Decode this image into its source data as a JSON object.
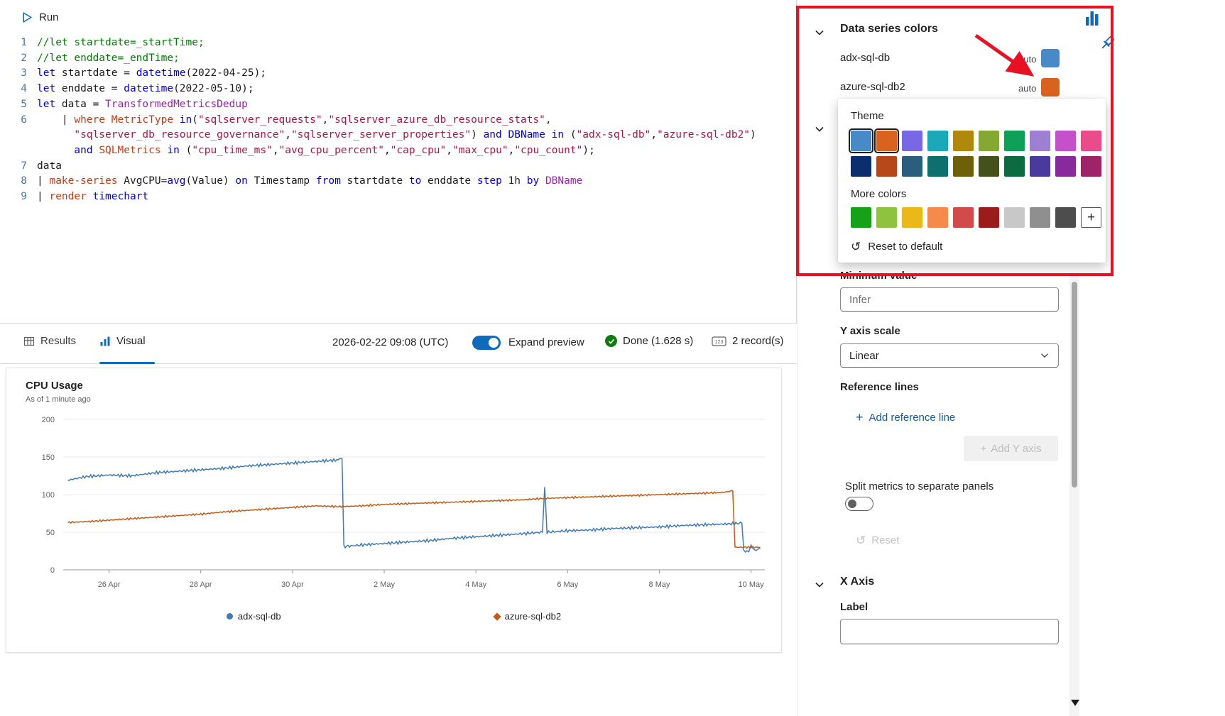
{
  "accent": "#0f6cbd",
  "annotation_color": "#e81123",
  "editor": {
    "run_label": "Run",
    "lines": [
      {
        "num": "1",
        "tokens": [
          [
            "comment",
            "//let startdate=_startTime;"
          ]
        ]
      },
      {
        "num": "2",
        "tokens": [
          [
            "comment",
            "//let enddate=_endTime;"
          ]
        ]
      },
      {
        "num": "3",
        "tokens": [
          [
            "kw",
            "let"
          ],
          [
            "plain",
            " startdate = "
          ],
          [
            "kw",
            "datetime"
          ],
          [
            "plain",
            "(2022-04-25);"
          ]
        ]
      },
      {
        "num": "4",
        "tokens": [
          [
            "kw",
            "let"
          ],
          [
            "plain",
            " enddate = "
          ],
          [
            "kw",
            "datetime"
          ],
          [
            "plain",
            "(2022-05-10);"
          ]
        ]
      },
      {
        "num": "5",
        "tokens": [
          [
            "kw",
            "let"
          ],
          [
            "plain",
            " data = "
          ],
          [
            "table",
            "TransformedMetricsDedup"
          ]
        ]
      },
      {
        "num": "6",
        "tokens": [
          [
            "plain",
            "    | "
          ],
          [
            "op",
            "where"
          ],
          [
            "plain",
            " "
          ],
          [
            "col",
            "MetricType"
          ],
          [
            "plain",
            " "
          ],
          [
            "kw",
            "in"
          ],
          [
            "plain",
            "("
          ],
          [
            "str",
            "\"sqlserver_requests\""
          ],
          [
            "plain",
            ","
          ],
          [
            "str",
            "\"sqlserver_azure_db_resource_stats\""
          ],
          [
            "plain",
            ","
          ]
        ]
      },
      {
        "num": "",
        "tokens": [
          [
            "plain",
            "      "
          ],
          [
            "str",
            "\"sqlserver_db_resource_governance\""
          ],
          [
            "plain",
            ","
          ],
          [
            "str",
            "\"sqlserver_server_properties\""
          ],
          [
            "plain",
            ") "
          ],
          [
            "kw",
            "and"
          ],
          [
            "plain",
            " "
          ],
          [
            "kw",
            "DBName"
          ],
          [
            "plain",
            " "
          ],
          [
            "kw",
            "in"
          ],
          [
            "plain",
            " ("
          ],
          [
            "str",
            "\"adx-sql-db\""
          ],
          [
            "plain",
            ","
          ],
          [
            "str",
            "\"azure-sql-db2\""
          ],
          [
            "plain",
            ")"
          ]
        ]
      },
      {
        "num": "",
        "tokens": [
          [
            "plain",
            "      "
          ],
          [
            "kw",
            "and"
          ],
          [
            "plain",
            " "
          ],
          [
            "col",
            "SQLMetrics"
          ],
          [
            "plain",
            " "
          ],
          [
            "kw",
            "in"
          ],
          [
            "plain",
            " ("
          ],
          [
            "str",
            "\"cpu_time_ms\""
          ],
          [
            "plain",
            ","
          ],
          [
            "str",
            "\"avg_cpu_percent\""
          ],
          [
            "plain",
            ","
          ],
          [
            "str",
            "\"cap_cpu\""
          ],
          [
            "plain",
            ","
          ],
          [
            "str",
            "\"max_cpu\""
          ],
          [
            "plain",
            ","
          ],
          [
            "str",
            "\"cpu_count\""
          ],
          [
            "plain",
            ");"
          ]
        ]
      },
      {
        "num": "7",
        "tokens": [
          [
            "plain",
            "data"
          ]
        ]
      },
      {
        "num": "8",
        "tokens": [
          [
            "plain",
            "| "
          ],
          [
            "op",
            "make-series"
          ],
          [
            "plain",
            " AvgCPU="
          ],
          [
            "fn",
            "avg"
          ],
          [
            "plain",
            "(Value) "
          ],
          [
            "kw",
            "on"
          ],
          [
            "plain",
            " Timestamp "
          ],
          [
            "kw",
            "from"
          ],
          [
            "plain",
            " startdate "
          ],
          [
            "kw",
            "to"
          ],
          [
            "plain",
            " enddate "
          ],
          [
            "kw",
            "step"
          ],
          [
            "plain",
            " 1h "
          ],
          [
            "kw",
            "by"
          ],
          [
            "plain",
            " "
          ],
          [
            "table",
            "DBName"
          ]
        ]
      },
      {
        "num": "9",
        "tokens": [
          [
            "plain",
            "| "
          ],
          [
            "op",
            "render"
          ],
          [
            "plain",
            " "
          ],
          [
            "kw",
            "timechart"
          ]
        ]
      }
    ]
  },
  "results_bar": {
    "results_tab": "Results",
    "visual_tab": "Visual",
    "timestamp": "2026-02-22 09:08 (UTC)",
    "expand_preview_label": "Expand preview",
    "expand_preview_on": true,
    "status_text": "Done (1.628 s)",
    "records_text": "2 record(s)"
  },
  "chart_data": {
    "type": "line",
    "title": "CPU Usage",
    "subtitle": "As of 1 minute ago",
    "ylabel": "",
    "xlabel": "",
    "ylim": [
      0,
      200
    ],
    "yticks": [
      0,
      50,
      100,
      150,
      200
    ],
    "x_start_date": "2022-04-25",
    "x_domain_days": [
      0,
      15.3
    ],
    "xticks": [
      {
        "d": 1,
        "label": "26 Apr"
      },
      {
        "d": 3,
        "label": "28 Apr"
      },
      {
        "d": 5,
        "label": "30 Apr"
      },
      {
        "d": 7,
        "label": "2 May"
      },
      {
        "d": 9,
        "label": "4 May"
      },
      {
        "d": 11,
        "label": "6 May"
      },
      {
        "d": 13,
        "label": "8 May"
      },
      {
        "d": 15,
        "label": "10 May"
      }
    ],
    "grid": "horizontal",
    "legend_position": "bottom",
    "series": [
      {
        "name": "adx-sql-db",
        "color": "#3e7ab8",
        "marker": "circle",
        "noise": 2.2,
        "seed": 3,
        "keypoints": [
          [
            0.1,
            119
          ],
          [
            0.5,
            124
          ],
          [
            1,
            126
          ],
          [
            1.5,
            125
          ],
          [
            2,
            129
          ],
          [
            2.5,
            131
          ],
          [
            3,
            133
          ],
          [
            3.5,
            135
          ],
          [
            4,
            138
          ],
          [
            4.5,
            140
          ],
          [
            5,
            142
          ],
          [
            5.5,
            144
          ],
          [
            6.0,
            146
          ],
          [
            6.08,
            148
          ],
          [
            6.12,
            31
          ],
          [
            6.5,
            33
          ],
          [
            7,
            35
          ],
          [
            7.5,
            37
          ],
          [
            8,
            39
          ],
          [
            8.5,
            42
          ],
          [
            9,
            44
          ],
          [
            9.5,
            46
          ],
          [
            10,
            48
          ],
          [
            10.45,
            50
          ],
          [
            10.5,
            110
          ],
          [
            10.55,
            50
          ],
          [
            11,
            52
          ],
          [
            11.5,
            53
          ],
          [
            12,
            55
          ],
          [
            12.5,
            56
          ],
          [
            13,
            57
          ],
          [
            13.5,
            59
          ],
          [
            14,
            60
          ],
          [
            14.5,
            61
          ],
          [
            14.8,
            62
          ],
          [
            14.84,
            25
          ],
          [
            14.95,
            24
          ],
          [
            15.0,
            33
          ],
          [
            15.05,
            26
          ],
          [
            15.2,
            28
          ]
        ]
      },
      {
        "name": "azure-sql-db2",
        "color": "#c55a11",
        "marker": "diamond",
        "noise": 1.4,
        "seed": 11,
        "keypoints": [
          [
            0.1,
            63
          ],
          [
            0.5,
            64
          ],
          [
            1,
            66
          ],
          [
            1.5,
            68
          ],
          [
            2,
            70
          ],
          [
            2.5,
            72
          ],
          [
            3,
            74
          ],
          [
            3.5,
            77
          ],
          [
            4,
            79
          ],
          [
            4.5,
            81
          ],
          [
            5,
            83
          ],
          [
            5.5,
            85
          ],
          [
            6,
            84
          ],
          [
            6.5,
            85
          ],
          [
            7,
            87
          ],
          [
            7.5,
            88
          ],
          [
            8,
            89
          ],
          [
            8.5,
            90
          ],
          [
            9,
            91
          ],
          [
            9.5,
            92
          ],
          [
            10,
            93
          ],
          [
            10.5,
            95
          ],
          [
            11,
            96
          ],
          [
            11.5,
            97
          ],
          [
            12,
            98
          ],
          [
            12.5,
            99
          ],
          [
            13,
            100
          ],
          [
            13.5,
            101
          ],
          [
            14,
            102
          ],
          [
            14.4,
            103
          ],
          [
            14.6,
            105
          ],
          [
            14.65,
            30
          ],
          [
            15.2,
            30
          ]
        ]
      }
    ]
  },
  "panel": {
    "data_series_colors": {
      "title": "Data series colors",
      "rows": [
        {
          "name": "adx-sql-db",
          "mode": "auto",
          "color": "#4a89c8"
        },
        {
          "name": "azure-sql-db2",
          "mode": "auto",
          "color": "#d9631e"
        }
      ]
    },
    "color_picker": {
      "theme_label": "Theme",
      "theme_rows": [
        [
          "#4a89c8",
          "#d9631e",
          "#7868e6",
          "#1ba8b8",
          "#b0880b",
          "#84a832",
          "#0fa058",
          "#9f7fd4",
          "#c451c9",
          "#ea4b8b"
        ],
        [
          "#0c2d6e",
          "#b5491a",
          "#2b5e7d",
          "#0e6f6f",
          "#6e5f09",
          "#44511a",
          "#0c6b40",
          "#4b3a9e",
          "#872a9e",
          "#9e2368"
        ]
      ],
      "selected_indices": [
        0,
        1
      ],
      "more_label": "More colors",
      "more_colors": [
        "#16a216",
        "#8fc33f",
        "#eab818",
        "#f58a4b",
        "#d24b4b",
        "#9c1c1c",
        "#c8c8c8",
        "#8f8f8f",
        "#4d4d4d"
      ],
      "add_custom_label": "+",
      "reset_label": "Reset to default"
    },
    "minimum_value_label": "Minimum value",
    "minimum_value_placeholder": "Infer",
    "y_axis_scale_label": "Y axis scale",
    "y_axis_scale_value": "Linear",
    "reference_lines_label": "Reference lines",
    "add_reference_line_label": "Add reference line",
    "add_y_axis_label": "Add Y axis",
    "split_label": "Split metrics to separate panels",
    "split_on": false,
    "reset_label": "Reset",
    "x_axis_title": "X Axis",
    "x_label_label": "Label",
    "x_label_value": ""
  }
}
